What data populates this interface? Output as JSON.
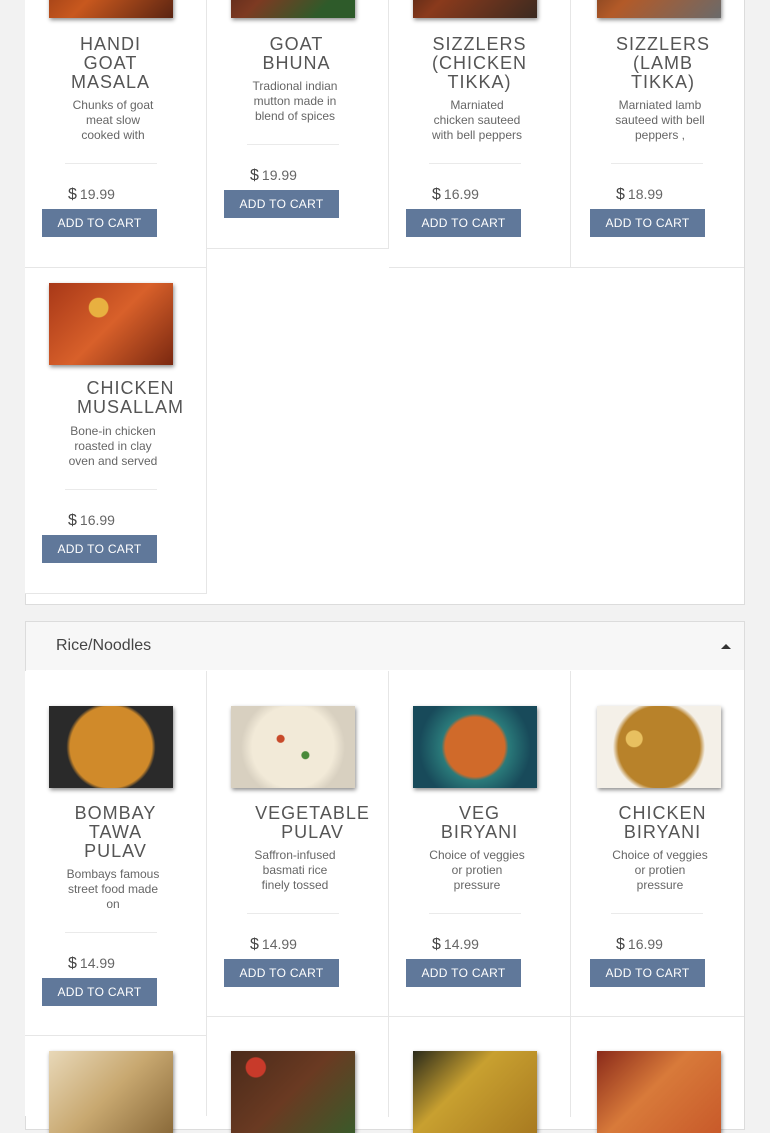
{
  "section1": {
    "items": [
      {
        "name": "HANDI GOAT MASALA",
        "desc": "Chunks of goat meat slow cooked with",
        "price": "19.99",
        "button": "ADD TO CART"
      },
      {
        "name": "GOAT BHUNA",
        "desc": "Tradional indian mutton made in blend of spices",
        "price": "19.99",
        "button": "ADD TO CART"
      },
      {
        "name": "SIZZLERS (CHICKEN TIKKA)",
        "desc": "Marniated chicken sauteed with bell peppers",
        "price": "16.99",
        "button": "ADD TO CART"
      },
      {
        "name": "SIZZLERS (LAMB TIKKA)",
        "desc": "Marniated lamb sauteed with bell peppers ,",
        "price": "18.99",
        "button": "ADD TO CART"
      },
      {
        "name": "CHICKEN MUSALLAM",
        "desc": "Bone-in chicken roasted in clay oven and served",
        "price": "16.99",
        "button": "ADD TO CART"
      }
    ]
  },
  "section2": {
    "title": "Rice/Noodles",
    "items": [
      {
        "name": "BOMBAY TAWA PULAV",
        "desc": "Bombays famous street food made on",
        "price": "14.99",
        "button": "ADD TO CART"
      },
      {
        "name": "VEGETABLE PULAV",
        "desc": "Saffron-infused basmati rice finely tossed",
        "price": "14.99",
        "button": "ADD TO CART"
      },
      {
        "name": "VEG BIRYANI",
        "desc": "Choice of veggies or protien pressure",
        "price": "14.99",
        "button": "ADD TO CART"
      },
      {
        "name": "CHICKEN BIRYANI",
        "desc": "Choice of veggies or protien pressure",
        "price": "16.99",
        "button": "ADD TO CART"
      }
    ]
  },
  "currency_symbol": "$",
  "icons": {
    "collapse": "caret-up-icon"
  }
}
